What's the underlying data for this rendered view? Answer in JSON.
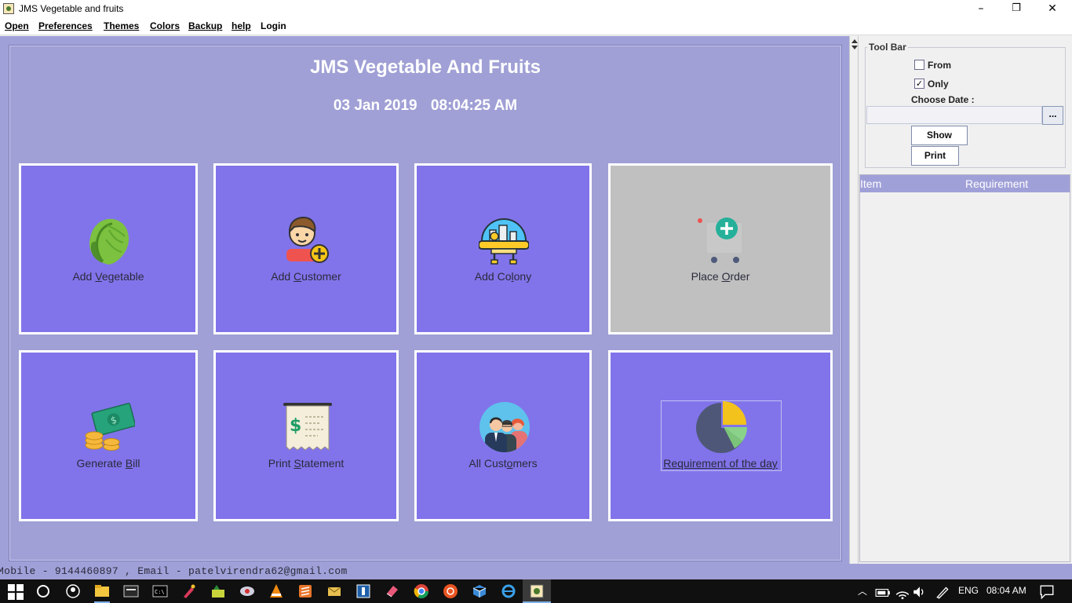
{
  "window": {
    "title": "JMS Vegetable and fruits",
    "minimize": "–",
    "restore": "❐",
    "close": "✕"
  },
  "menu": [
    "Open",
    "Preferences",
    "Themes",
    "Colors",
    "Backup",
    "help",
    "Login"
  ],
  "header": {
    "title": "JMS Vegetable And Fruits",
    "date": "03 Jan 2019",
    "time": "08:04:25 AM"
  },
  "tiles": [
    {
      "pre": "Add ",
      "mn": "V",
      "post": "egetable",
      "icon": "lettuce-icon"
    },
    {
      "pre": "Add ",
      "mn": "C",
      "post": "ustomer",
      "icon": "customer-add-icon"
    },
    {
      "pre": "Add Co",
      "mn": "l",
      "post": "ony",
      "icon": "colony-dome-icon"
    },
    {
      "pre": "Place ",
      "mn": "O",
      "post": "rder",
      "icon": "cart-add-icon",
      "disabled": true
    },
    {
      "pre": "Generate ",
      "mn": "B",
      "post": "ill",
      "icon": "money-coins-icon"
    },
    {
      "pre": "Print ",
      "mn": "S",
      "post": "tatement",
      "icon": "receipt-icon"
    },
    {
      "pre": "All Cust",
      "mn": "o",
      "post": "mers",
      "icon": "people-group-icon"
    },
    {
      "pre": "",
      "mn": "R",
      "post": "equirement of the day",
      "icon": "pie-chart-icon"
    }
  ],
  "toolbar": {
    "legend": "Tool Bar",
    "from_label": "From",
    "from_checked": false,
    "only_label": "Only",
    "only_checked": true,
    "choose_date_label": "Choose Date :",
    "date_value": "",
    "date_button": "...",
    "show_button": "Show",
    "print_button": "Print"
  },
  "table": {
    "columns": [
      "Item",
      "Requirement"
    ],
    "rows": []
  },
  "status": "Mobile - 9144460897 , Email - patelvirendra62@gmail.com",
  "taskbar": {
    "language": "ENG",
    "clock": "08:04 AM"
  },
  "colors": {
    "tile": "#8174ea",
    "tile_disabled": "#c0c0c0",
    "panel": "#a0a0d9"
  }
}
